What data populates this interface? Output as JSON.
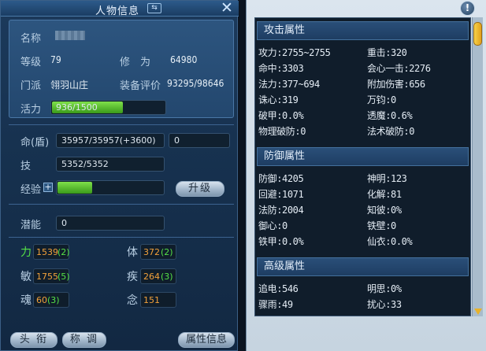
{
  "left": {
    "title": "人物信息",
    "title_icon": "⇆",
    "close": "✕",
    "info": {
      "name_label": "名称",
      "level_label": "等级",
      "level": "79",
      "cultivation_label": "修　为",
      "cultivation": "64980",
      "faction_label": "门派",
      "faction": "翎羽山庄",
      "equip_label": "装备评价",
      "equip": "93295/98646",
      "vitality_label": "活力",
      "vitality": "936/1500",
      "vitality_ratio": 0.624
    },
    "hp_label": "命(盾)",
    "hp": "35957/35957(+3600)",
    "shield": "0",
    "skill_label": "技",
    "skill": "5352/5352",
    "exp_label": "经验",
    "exp_plus": "+",
    "exp_ratio": 0.32,
    "upgrade_button": "升级",
    "potential_label": "潜能",
    "potential": "0",
    "stats": [
      {
        "label": "力",
        "value": "1539",
        "bonus": "(2)"
      },
      {
        "label": "体",
        "value": "372",
        "bonus": "(2)"
      },
      {
        "label": "敏",
        "value": "1755",
        "bonus": "(5)"
      },
      {
        "label": "疾",
        "value": "264",
        "bonus": "(3)"
      },
      {
        "label": "魂",
        "value": "60",
        "bonus": "(3)"
      },
      {
        "label": "念",
        "value": "151",
        "bonus": ""
      }
    ],
    "buttons": {
      "title_btn": "头 衔",
      "appellation_btn": "称 调",
      "attr_btn": "属性信息"
    }
  },
  "right": {
    "help": "!",
    "sections": [
      {
        "title": "攻击属性",
        "rows": [
          [
            "攻力:2755~2755",
            "重击:320"
          ],
          [
            "命中:3303",
            "会心一击:2276"
          ],
          [
            "法力:377~694",
            "附加伤害:656"
          ],
          [
            "诛心:319",
            "万钧:0"
          ],
          [
            "破甲:0.0%",
            "透魔:0.6%"
          ],
          [
            "物理破防:0",
            "法术破防:0"
          ]
        ]
      },
      {
        "title": "防御属性",
        "rows": [
          [
            "防御:4205",
            "神明:123"
          ],
          [
            "回避:1071",
            "化解:81"
          ],
          [
            "法防:2004",
            "知彼:0%"
          ],
          [
            "御心:0",
            "铁壁:0"
          ],
          [
            "铁甲:0.0%",
            "仙衣:0.0%"
          ]
        ]
      },
      {
        "title": "高级属性",
        "rows": [
          [
            "追电:546",
            "明思:0%"
          ],
          [
            "骤雨:49",
            "扰心:33"
          ]
        ]
      }
    ]
  }
}
